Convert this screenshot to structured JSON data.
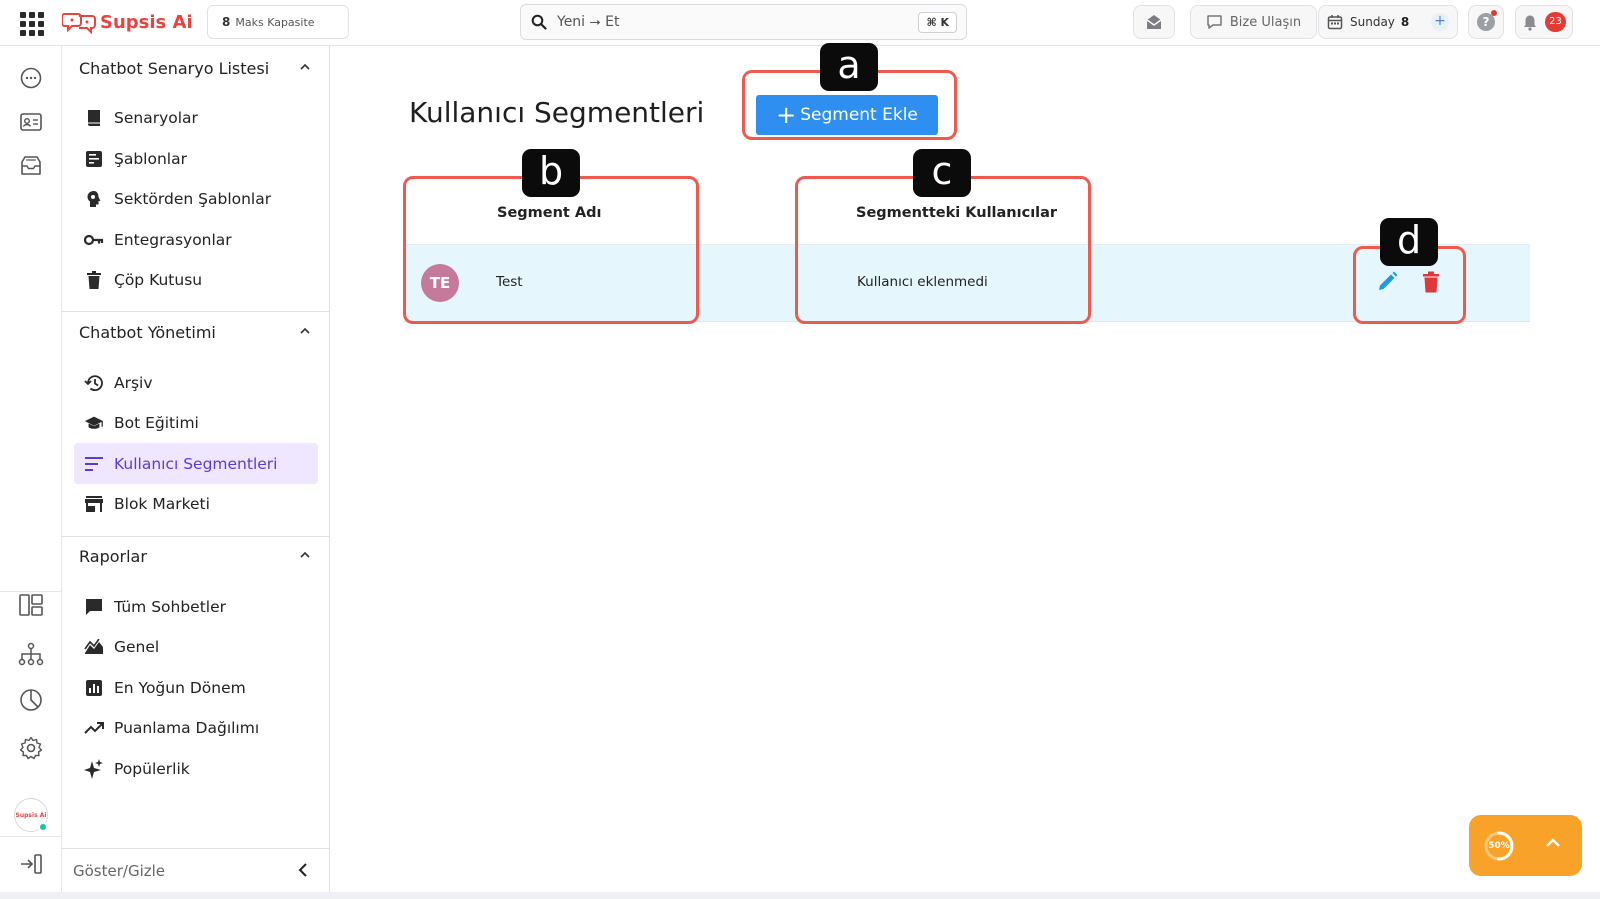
{
  "topbar": {
    "brand": "Supsis Ai",
    "capacity": {
      "number": "8",
      "label": "Maks Kapasite"
    },
    "search": {
      "value": "Yeni ⭢ Et",
      "shortcut": "⌘ K"
    },
    "contact_label": "Bize Ulaşın",
    "day": {
      "label": "Sunday",
      "number": "8"
    },
    "notification_count": "23"
  },
  "rail": {
    "avatar_text": "Supsis Ai"
  },
  "sidebar": {
    "sections": [
      {
        "title": "Chatbot Senaryo Listesi",
        "items": [
          {
            "label": "Senaryolar",
            "icon": "book-icon"
          },
          {
            "label": "Şablonlar",
            "icon": "template-icon"
          },
          {
            "label": "Sektörden Şablonlar",
            "icon": "brain-icon"
          },
          {
            "label": "Entegrasyonlar",
            "icon": "key-icon"
          },
          {
            "label": "Çöp Kutusu",
            "icon": "trash-icon"
          }
        ]
      },
      {
        "title": "Chatbot Yönetimi",
        "items": [
          {
            "label": "Arşiv",
            "icon": "history-icon"
          },
          {
            "label": "Bot Eğitimi",
            "icon": "graduation-cap-icon"
          },
          {
            "label": "Kullanıcı Segmentleri",
            "icon": "sort-lines-icon",
            "active": true
          },
          {
            "label": "Blok Marketi",
            "icon": "store-icon"
          }
        ]
      },
      {
        "title": "Raporlar",
        "items": [
          {
            "label": "Tüm Sohbetler",
            "icon": "chat-icon"
          },
          {
            "label": "Genel",
            "icon": "area-chart-icon"
          },
          {
            "label": "En Yoğun Dönem",
            "icon": "bar-chart-icon"
          },
          {
            "label": "Puanlama Dağılımı",
            "icon": "trending-icon"
          },
          {
            "label": "Popülerlik",
            "icon": "sparkle-icon"
          }
        ]
      }
    ],
    "toggle_label": "Göster/Gizle"
  },
  "main": {
    "title": "Kullanıcı Segmentleri",
    "add_button_label": "Segment Ekle",
    "table": {
      "headers": [
        "Segment Adı",
        "Segmentteki Kullanıcılar"
      ],
      "rows": [
        {
          "initials": "TE",
          "name": "Test",
          "users": "Kullanıcı eklenmedi",
          "avatar_color": "#c67a9b"
        }
      ]
    }
  },
  "annotations": {
    "a": "a",
    "b": "b",
    "c": "c",
    "d": "d"
  },
  "progress": {
    "percent_label": "50%",
    "value": 0.5
  },
  "colors": {
    "brand": "#e8443f",
    "primary": "#2f8ff0",
    "annotation": "#ef5a4f",
    "active_nav_bg": "#eee7ff",
    "accent_orange": "#f9a229"
  }
}
